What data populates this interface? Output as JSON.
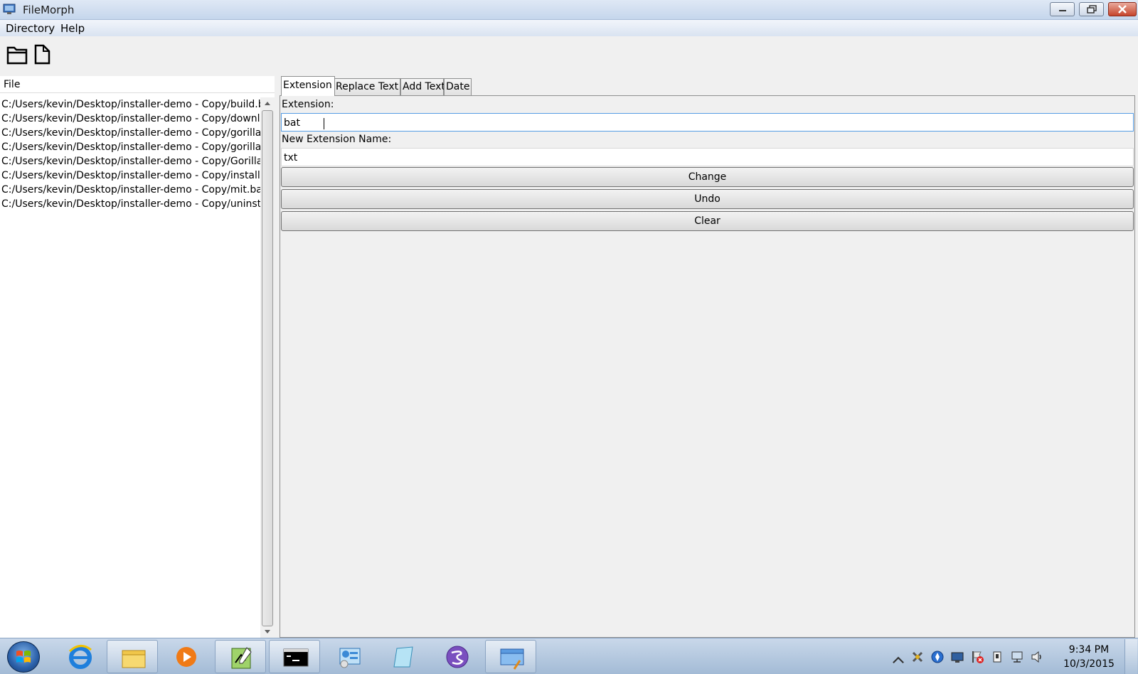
{
  "window": {
    "title": "FileMorph"
  },
  "menu": {
    "items": [
      "Directory",
      "Help"
    ]
  },
  "file_list": {
    "header": "File",
    "rows": [
      "C:/Users/kevin/Desktop/installer-demo - Copy/build.bat",
      "C:/Users/kevin/Desktop/installer-demo - Copy/download.bat",
      "C:/Users/kevin/Desktop/installer-demo - Copy/gorilla.exe",
      "C:/Users/kevin/Desktop/installer-demo - Copy/gorilla.sh",
      "C:/Users/kevin/Desktop/installer-demo - Copy/Gorilla_",
      "C:/Users/kevin/Desktop/installer-demo - Copy/install.bat",
      "C:/Users/kevin/Desktop/installer-demo - Copy/mit.bat",
      "C:/Users/kevin/Desktop/installer-demo - Copy/uninstall.bat"
    ]
  },
  "tabs": [
    "Extension",
    "Replace Text",
    "Add Text",
    "Date"
  ],
  "extension_tab": {
    "extension_label": "Extension:",
    "extension_value": "bat",
    "new_name_label": "New Extension Name:",
    "new_name_value": "txt",
    "change_label": "Change",
    "undo_label": "Undo",
    "clear_label": "Clear"
  },
  "taskbar": {
    "clock_time": "9:34 PM",
    "clock_date": "10/3/2015"
  }
}
